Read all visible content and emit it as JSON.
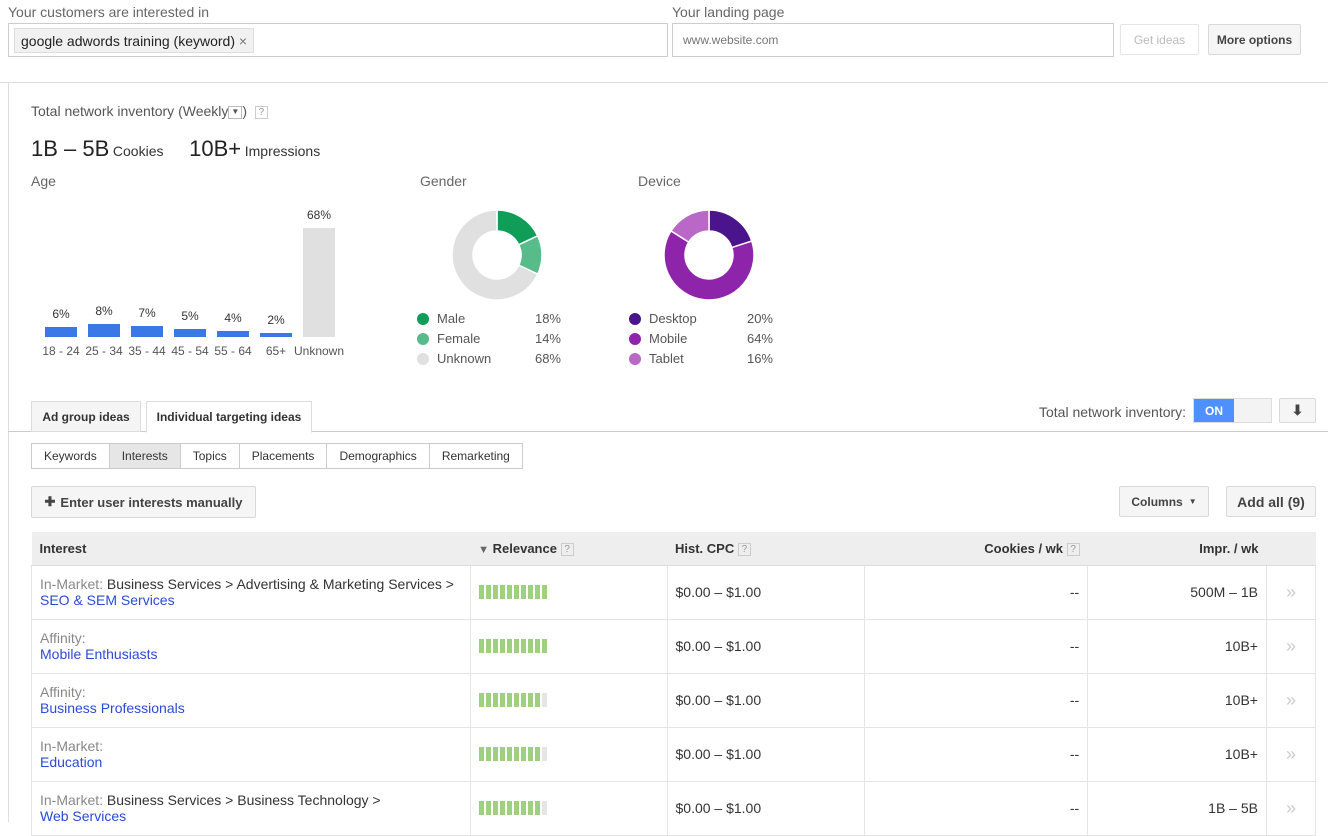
{
  "search": {
    "interest_label": "Your customers are interested in",
    "chip": "google adwords training (keyword)",
    "landing_label": "Your landing page",
    "landing_placeholder": "www.website.com",
    "get_ideas": "Get ideas",
    "more_options": "More options"
  },
  "inventory": {
    "title": "Total network inventory",
    "period": "(Weekly",
    "period_close": ")",
    "cookies_value": "1B – 5B",
    "cookies_label": "Cookies",
    "impr_value": "10B+",
    "impr_label": "Impressions"
  },
  "age": {
    "title": "Age",
    "categories": [
      "18 - 24",
      "25 - 34",
      "35 - 44",
      "45 - 54",
      "55 - 64",
      "65+",
      "Unknown"
    ],
    "values": [
      6,
      8,
      7,
      5,
      4,
      2,
      68
    ],
    "labels": [
      "6%",
      "8%",
      "7%",
      "5%",
      "4%",
      "2%",
      "68%"
    ],
    "colors": {
      "known": "#3b78e7",
      "unknown": "#e0e0e0"
    }
  },
  "gender": {
    "title": "Gender",
    "items": [
      {
        "label": "Male",
        "value": 18,
        "pct": "18%",
        "color": "#0f9d58"
      },
      {
        "label": "Female",
        "value": 14,
        "pct": "14%",
        "color": "#57bb8a"
      },
      {
        "label": "Unknown",
        "value": 68,
        "pct": "68%",
        "color": "#e0e0e0"
      }
    ]
  },
  "device": {
    "title": "Device",
    "items": [
      {
        "label": "Desktop",
        "value": 20,
        "pct": "20%",
        "color": "#4a148c"
      },
      {
        "label": "Mobile",
        "value": 64,
        "pct": "64%",
        "color": "#8e24aa"
      },
      {
        "label": "Tablet",
        "value": 16,
        "pct": "16%",
        "color": "#ba68c8"
      }
    ]
  },
  "tabs": [
    "Ad group ideas",
    "Individual targeting ideas"
  ],
  "toggle": {
    "label": "Total network inventory:",
    "state": "ON"
  },
  "subtabs": [
    "Keywords",
    "Interests",
    "Topics",
    "Placements",
    "Demographics",
    "Remarketing"
  ],
  "actions": {
    "enter": "Enter user interests manually",
    "columns": "Columns",
    "add_all": "Add all (9)"
  },
  "table": {
    "headers": [
      "Interest",
      "Relevance",
      "Hist. CPC",
      "Cookies / wk",
      "Impr. / wk"
    ],
    "rows": [
      {
        "cat": "In-Market:",
        "path": "Business Services > Advertising & Marketing Services >",
        "link": "SEO & SEM Services",
        "relevance": 10,
        "cpc": "$0.00 – $1.00",
        "cookies": "--",
        "impr": "500M – 1B"
      },
      {
        "cat": "Affinity:",
        "path": "",
        "link": "Mobile Enthusiasts",
        "relevance": 10,
        "cpc": "$0.00 – $1.00",
        "cookies": "--",
        "impr": "10B+"
      },
      {
        "cat": "Affinity:",
        "path": "",
        "link": "Business Professionals",
        "relevance": 9,
        "cpc": "$0.00 – $1.00",
        "cookies": "--",
        "impr": "10B+"
      },
      {
        "cat": "In-Market:",
        "path": "",
        "link": "Education",
        "relevance": 9,
        "cpc": "$0.00 – $1.00",
        "cookies": "--",
        "impr": "10B+"
      },
      {
        "cat": "In-Market:",
        "path": "Business Services > Business Technology >",
        "link": "Web Services",
        "relevance": 9,
        "cpc": "$0.00 – $1.00",
        "cookies": "--",
        "impr": "1B – 5B"
      }
    ]
  }
}
